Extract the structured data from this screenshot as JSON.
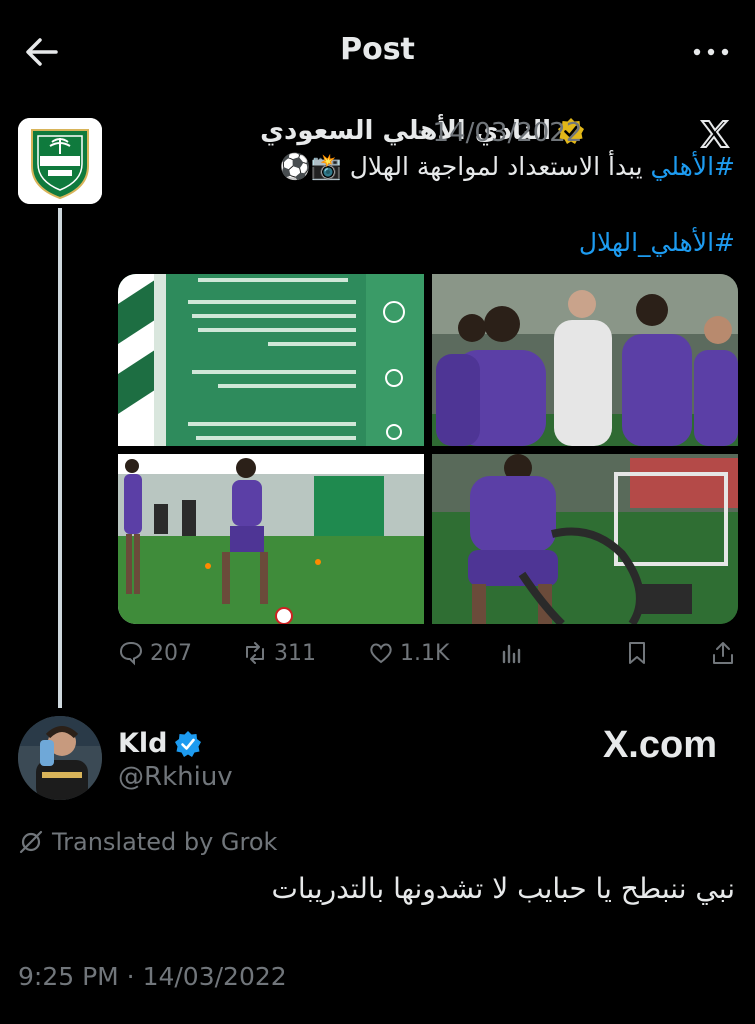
{
  "header": {
    "title": "Post",
    "back_icon": "arrow-left-icon",
    "more_icon": "more-horizontal-icon"
  },
  "quoted": {
    "author": "النادي الأهلي السعودي",
    "verified": "gold",
    "separator": "·",
    "date": "14/03/2022",
    "text_hashtag": "#الأهلي",
    "text_body": " يبدأ الاستعداد لمواجهة الهلال 📸⚽",
    "hashtag2": "#الأهلي_الهلال",
    "stats": {
      "replies": "207",
      "reposts": "311",
      "likes": "1.1K"
    },
    "media": [
      "infographic-card",
      "team-huddle-photo",
      "player-dribbling-photo",
      "battle-rope-training-photo"
    ]
  },
  "reply": {
    "name": "Kld",
    "verified": "blue",
    "handle": "@Rkhiuv",
    "watermark": "X.com",
    "translated_label": "Translated by Grok",
    "text": "نبي ننبطح يا حبايب لا تشدونها بالتدريبات",
    "timestamp": "9:25 PM · 14/03/2022"
  },
  "colors": {
    "background": "#000000",
    "text": "#e7e9ea",
    "muted": "#71767b",
    "accent": "#1d9bf0",
    "gold": "#e2b719"
  }
}
